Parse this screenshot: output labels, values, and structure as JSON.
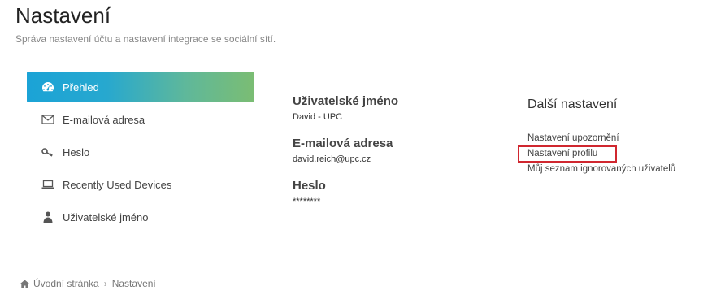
{
  "header": {
    "title": "Nastavení",
    "subtitle": "Správa nastavení účtu a nastavení integrace se sociální sítí."
  },
  "sidebar": {
    "items": [
      {
        "label": "Přehled",
        "icon": "dashboard-icon",
        "active": true
      },
      {
        "label": "E-mailová adresa",
        "icon": "envelope-icon",
        "active": false
      },
      {
        "label": "Heslo",
        "icon": "key-icon",
        "active": false
      },
      {
        "label": "Recently Used Devices",
        "icon": "laptop-icon",
        "active": false
      },
      {
        "label": "Uživatelské jméno",
        "icon": "user-icon",
        "active": false
      }
    ]
  },
  "overview": {
    "username_label": "Uživatelské jméno",
    "username_value": "David - UPC",
    "email_label": "E-mailová adresa",
    "email_value": "david.reich@upc.cz",
    "password_label": "Heslo",
    "password_value": "********"
  },
  "more_settings": {
    "title": "Další nastavení",
    "links": [
      {
        "label": "Nastavení upozornění"
      },
      {
        "label": "Nastavení profilu"
      },
      {
        "label": "Můj seznam ignorovaných uživatelů"
      }
    ]
  },
  "breadcrumb": {
    "home": "Úvodní stránka",
    "current": "Nastavení"
  },
  "colors": {
    "accent_start": "#1ba3d6",
    "accent_end": "#7bbd73",
    "highlight": "#d0272f"
  }
}
